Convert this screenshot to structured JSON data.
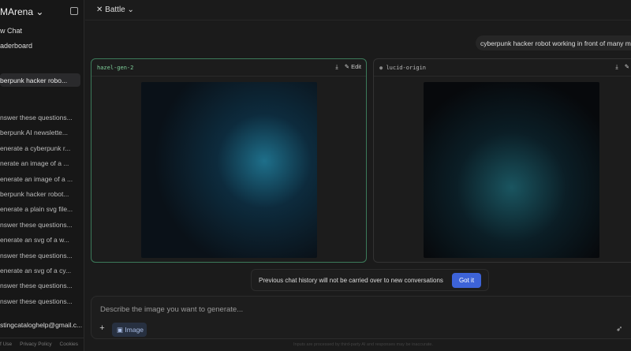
{
  "sidebar": {
    "brand": "MArena",
    "new_chat": "w Chat",
    "leaderboard": "aderboard",
    "active": "berpunk hacker robo...",
    "history": [
      "nswer these questions...",
      "berpunk AI newslette...",
      "enerate a cyberpunk r...",
      "nerate an image of a ...",
      "enerate an image of a ...",
      "berpunk hacker robot...",
      "enerate a plain svg file...",
      "nswer these questions...",
      "enerate an svg of a w...",
      "nswer these questions...",
      "enerate an svg of a cy...",
      "nswer these questions...",
      "nswer these questions..."
    ],
    "email": "stingcataloghelp@gmail.c...",
    "footer": [
      "f Use",
      "Privacy Policy",
      "Cookies"
    ]
  },
  "header": {
    "mode": "Battle"
  },
  "prompt": "cyberpunk hacker robot working in front of many monitors",
  "cards": [
    {
      "model": "hazel-gen-2",
      "edit": "Edit"
    },
    {
      "model": "lucid-origin"
    }
  ],
  "toast": {
    "text": "Previous chat history will not be carried over to new conversations",
    "button": "Got it"
  },
  "input": {
    "placeholder": "Describe the image you want to generate...",
    "image_button": "Image"
  },
  "footer": "Inputs are processed by third-party AI and responses may be inaccurate."
}
